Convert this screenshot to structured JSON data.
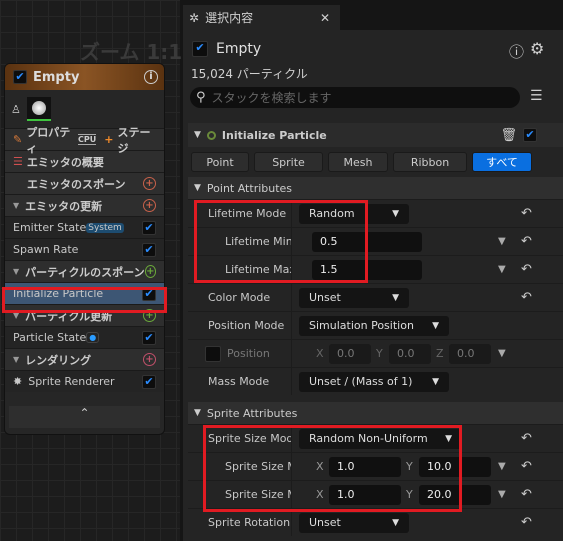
{
  "graph": {
    "zoom_label": "ズーム 1:1"
  },
  "node": {
    "title": "Empty",
    "properties_label": "プロパティ",
    "cpu_badge": "CPU",
    "stage_label": "ステージ",
    "items": [
      {
        "label": "エミッタの概要",
        "type": "summary"
      },
      {
        "label": "エミッタのスポーン",
        "type": "section",
        "color": "#c8614a"
      },
      {
        "label": "エミッタの更新",
        "type": "section",
        "color": "#c8614a"
      },
      {
        "label": "Emitter State",
        "badge": "System",
        "type": "item"
      },
      {
        "label": "Spawn Rate",
        "type": "item"
      },
      {
        "label": "パーティクルのスポーン",
        "type": "section",
        "color": "#6aa83a"
      },
      {
        "label": "Initialize Particle",
        "type": "item",
        "selected": true
      },
      {
        "label": "パーティクル更新",
        "type": "section",
        "color": "#6aa83a"
      },
      {
        "label": "Particle State",
        "type": "item"
      },
      {
        "label": "レンダリング",
        "type": "section",
        "color": "#c0506a"
      },
      {
        "label": "Sprite Renderer",
        "type": "item"
      }
    ]
  },
  "panel": {
    "tab_title": "選択内容",
    "emitter_name": "Empty",
    "particle_count": "15,024 パーティクル",
    "search_placeholder": "スタックを検索します",
    "module_title": "Initialize Particle",
    "filter_tabs": [
      "Point",
      "Sprite",
      "Mesh",
      "Ribbon",
      "すべて"
    ],
    "active_tab": "すべて",
    "point_section": "Point Attributes",
    "rows": {
      "lifetime_mode": {
        "label": "Lifetime Mode",
        "value": "Random"
      },
      "lifetime_min": {
        "label": "Lifetime Min",
        "value": "0.5"
      },
      "lifetime_max": {
        "label": "Lifetime Max",
        "value": "1.5"
      },
      "color_mode": {
        "label": "Color Mode",
        "value": "Unset"
      },
      "position_mode": {
        "label": "Position Mode",
        "value": "Simulation Position"
      },
      "position": {
        "label": "Position",
        "x": "0.0",
        "y": "0.0",
        "z": "0.0"
      },
      "mass_mode": {
        "label": "Mass Mode",
        "value": "Unset / (Mass of 1)"
      },
      "sprite_size_mode": {
        "label": "Sprite Size Mode",
        "value": "Random Non-Uniform"
      },
      "sprite_size_min": {
        "label": "Sprite Size Min",
        "x": "1.0",
        "y": "10.0"
      },
      "sprite_size_max": {
        "label": "Sprite Size Max",
        "x": "1.0",
        "y": "20.0"
      },
      "sprite_rotation": {
        "label": "Sprite Rotation",
        "value": "Unset"
      }
    },
    "sprite_section": "Sprite Attributes",
    "axis": {
      "x": "X",
      "y": "Y",
      "z": "Z"
    }
  },
  "colors": {
    "accent": "#0a6fe0",
    "highlight": "#e11b22"
  }
}
